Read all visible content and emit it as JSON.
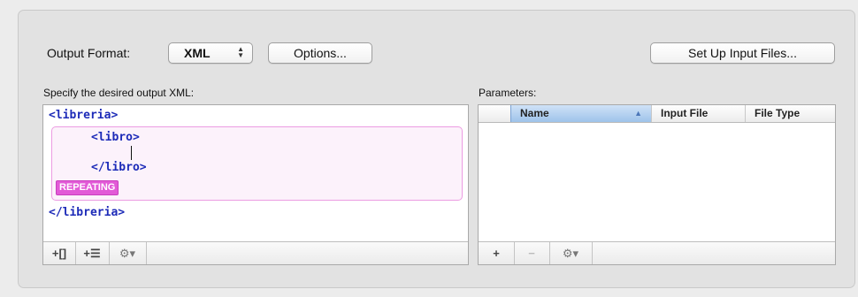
{
  "output_format": {
    "label": "Output Format:",
    "value": "XML",
    "popup_arrows": "▲▼"
  },
  "buttons": {
    "options": "Options...",
    "setup_input": "Set Up Input Files..."
  },
  "xml_section": {
    "label": "Specify the desired output XML:",
    "lines": {
      "root_open": "<libreria>",
      "child_open": "<libro>",
      "child_close": "</libro>",
      "root_close": "</libreria>"
    },
    "badge": "REPEATING",
    "toolbar": {
      "add_bracket": "+[]",
      "add_list": "+☰",
      "gear": "⚙▾"
    }
  },
  "parameters": {
    "label": "Parameters:",
    "columns": [
      "Name",
      "Input File",
      "File Type"
    ],
    "sorted_column": "Name",
    "sort_indicator": "▲",
    "rows": [],
    "toolbar": {
      "add": "+",
      "remove": "−",
      "gear": "⚙▾"
    }
  },
  "colors": {
    "code": "#1d2bb8",
    "badge": "#e25ad7",
    "repeat_border": "#ec9ce2",
    "sorted_header": "#9ec3ea"
  }
}
